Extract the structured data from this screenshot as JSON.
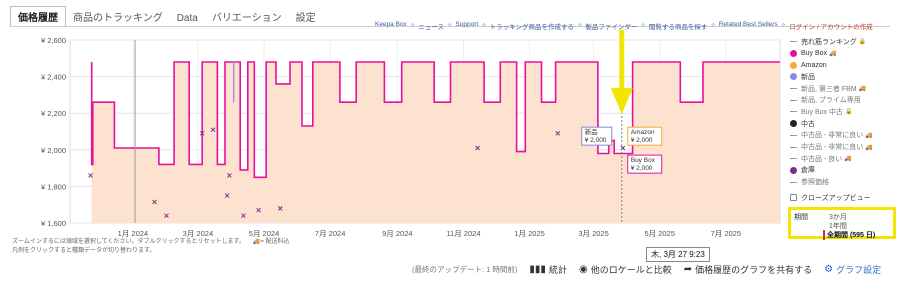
{
  "tabs": [
    "価格履歴",
    "商品のトラッキング",
    "Data",
    "バリエーション",
    "設定"
  ],
  "top_links": [
    "Keepa Box",
    "ニュース",
    "Support",
    "トラッキング商品を作成する",
    "製品ファインダー",
    "閲覧する商品を探す",
    "Related Best Sellers",
    "ログイン / アカウントの作成"
  ],
  "legend": [
    {
      "label": "売れ筋ランキング",
      "color": "",
      "icon": "line",
      "off": false,
      "extra": "lock"
    },
    {
      "label": "Buy Box",
      "color": "#e6109d",
      "icon": "dot",
      "off": false,
      "extra": "truck"
    },
    {
      "label": "Amazon",
      "color": "#f2a93b",
      "icon": "dot",
      "off": false,
      "extra": ""
    },
    {
      "label": "新品",
      "color": "#8888dd",
      "icon": "dot",
      "off": false,
      "extra": ""
    },
    {
      "label": "新品, 第三者 FBM",
      "color": "",
      "icon": "line",
      "off": true,
      "extra": "truck"
    },
    {
      "label": "新品, プライム専用",
      "color": "",
      "icon": "line",
      "off": true,
      "extra": ""
    },
    {
      "label": "Buy Box 中古",
      "color": "",
      "icon": "line",
      "off": true,
      "extra": "lock"
    },
    {
      "label": "中古",
      "color": "#222222",
      "icon": "dot",
      "off": false,
      "extra": ""
    },
    {
      "label": "中古品 - 非常に良い",
      "color": "",
      "icon": "line",
      "off": true,
      "extra": "truck"
    },
    {
      "label": "中古品 - 非常に良い",
      "color": "",
      "icon": "line",
      "off": true,
      "extra": "truck"
    },
    {
      "label": "中古品 - 良い",
      "color": "",
      "icon": "line",
      "off": true,
      "extra": "truck"
    },
    {
      "label": "倉庫",
      "color": "#7b2d8e",
      "icon": "dot",
      "off": false,
      "extra": ""
    },
    {
      "label": "参照価格",
      "color": "",
      "icon": "line",
      "off": true,
      "extra": ""
    },
    {
      "label": "クローズアップビュー",
      "color": "",
      "icon": "toggle",
      "off": false,
      "extra": ""
    }
  ],
  "zoom": {
    "header": "期間",
    "options": [
      "3か月",
      "1年間"
    ],
    "selected": "全期間 (595 日)"
  },
  "notes": [
    "ズームインするには領域を選択してください。ダブルクリックするとリセットします。",
    "凡例をクリックすると種類データが切り替わります。"
  ],
  "truck_note": "= 配送料込",
  "hover": {
    "date": "木, 3月 27 9:23",
    "new_label": "新品",
    "new_price": "¥ 2,000",
    "amazon_label": "Amazon",
    "amazon_price": "¥ 2,000",
    "buybox_label": "Buy Box",
    "buybox_price": "¥ 2,000"
  },
  "footer": {
    "update": "(最終のアップデート: 1 時間前)",
    "stats": "統計",
    "compare": "他のロケールと比較",
    "share": "価格履歴のグラフを共有する",
    "settings": "グラフ設定"
  },
  "chart_data": {
    "type": "line",
    "ylim": [
      1600,
      2600
    ],
    "yticks": [
      1600,
      1800,
      2000,
      2200,
      2400,
      2600
    ],
    "ytick_labels": [
      "¥ 1,600",
      "¥ 1,800",
      "¥ 2,000",
      "¥ 2,200",
      "¥ 2,400",
      "¥ 2,600"
    ],
    "xlim": [
      "2023-11-04",
      "2025-08-20"
    ],
    "xticks": [
      "2024-01-01",
      "2024-03-01",
      "2024-05-01",
      "2024-07-01",
      "2024-09-01",
      "2024-11-01",
      "2025-01-01",
      "2025-03-01",
      "2025-05-01",
      "2025-07-01"
    ],
    "xtick_labels": [
      "1月 2024",
      "3月 2024",
      "5月 2024",
      "7月 2024",
      "9月 2024",
      "11月 2024",
      "1月 2025",
      "3月 2025",
      "5月 2025",
      "7月 2025"
    ],
    "series": [
      {
        "name": "Buy Box",
        "color": "#e6109d",
        "points": [
          [
            "2023-11-24",
            2480
          ],
          [
            "2023-11-24",
            1920
          ],
          [
            "2023-11-25",
            1920
          ],
          [
            "2023-11-25",
            2260
          ],
          [
            "2023-12-15",
            2260
          ],
          [
            "2023-12-15",
            2010
          ],
          [
            "2024-01-25",
            2010
          ],
          [
            "2024-01-25",
            1920
          ],
          [
            "2024-02-08",
            1920
          ],
          [
            "2024-02-08",
            2480
          ],
          [
            "2024-02-22",
            2480
          ],
          [
            "2024-02-22",
            1920
          ],
          [
            "2024-03-05",
            1920
          ],
          [
            "2024-03-05",
            2480
          ],
          [
            "2024-03-19",
            2480
          ],
          [
            "2024-03-19",
            1920
          ],
          [
            "2024-03-26",
            1920
          ],
          [
            "2024-03-26",
            2480
          ],
          [
            "2024-04-09",
            2480
          ],
          [
            "2024-04-09",
            1890
          ],
          [
            "2024-04-16",
            1890
          ],
          [
            "2024-04-16",
            2480
          ],
          [
            "2024-04-22",
            2480
          ],
          [
            "2024-04-22",
            1850
          ],
          [
            "2024-05-03",
            1850
          ],
          [
            "2024-05-03",
            2480
          ],
          [
            "2024-05-12",
            2480
          ],
          [
            "2024-05-12",
            2360
          ],
          [
            "2024-05-25",
            2360
          ],
          [
            "2024-05-25",
            2480
          ],
          [
            "2024-06-05",
            2480
          ],
          [
            "2024-06-05",
            2130
          ],
          [
            "2024-06-15",
            2130
          ],
          [
            "2024-06-15",
            2480
          ],
          [
            "2024-07-10",
            2480
          ],
          [
            "2024-07-10",
            2260
          ],
          [
            "2024-07-25",
            2260
          ],
          [
            "2024-07-25",
            2480
          ],
          [
            "2024-08-20",
            2480
          ],
          [
            "2024-08-20",
            2260
          ],
          [
            "2024-09-05",
            2260
          ],
          [
            "2024-09-05",
            2480
          ],
          [
            "2024-10-05",
            2480
          ],
          [
            "2024-10-05",
            2260
          ],
          [
            "2024-10-20",
            2260
          ],
          [
            "2024-10-20",
            2480
          ],
          [
            "2024-11-20",
            2480
          ],
          [
            "2024-11-20",
            2260
          ],
          [
            "2024-12-05",
            2260
          ],
          [
            "2024-12-05",
            2480
          ],
          [
            "2024-12-20",
            2480
          ],
          [
            "2024-12-20",
            1990
          ],
          [
            "2024-12-28",
            1990
          ],
          [
            "2024-12-28",
            2480
          ],
          [
            "2025-01-12",
            2480
          ],
          [
            "2025-01-12",
            2260
          ],
          [
            "2025-01-25",
            2260
          ],
          [
            "2025-01-25",
            2480
          ],
          [
            "2025-03-05",
            2480
          ],
          [
            "2025-03-05",
            1980
          ],
          [
            "2025-03-15",
            1980
          ],
          [
            "2025-03-15",
            2050
          ],
          [
            "2025-03-20",
            2050
          ],
          [
            "2025-03-20",
            1980
          ],
          [
            "2025-04-06",
            1980
          ],
          [
            "2025-04-06",
            2480
          ],
          [
            "2025-05-20",
            2480
          ],
          [
            "2025-05-20",
            2260
          ],
          [
            "2025-06-10",
            2260
          ],
          [
            "2025-06-10",
            2480
          ],
          [
            "2025-08-20",
            2480
          ]
        ]
      },
      {
        "name": "新品",
        "color": "#8888dd",
        "points": [
          [
            "2024-04-03",
            2260
          ],
          [
            "2024-04-03",
            2480
          ],
          [
            "2024-04-05",
            2480
          ]
        ]
      },
      {
        "name": "中古",
        "color": "#7b2d8e",
        "type": "scatter",
        "points": [
          [
            "2023-11-23",
            1860
          ],
          [
            "2024-01-21",
            1715
          ],
          [
            "2024-02-01",
            1640
          ],
          [
            "2024-03-05",
            2090
          ],
          [
            "2024-03-15",
            2110
          ],
          [
            "2024-03-28",
            1750
          ],
          [
            "2024-03-30",
            1860
          ],
          [
            "2024-04-12",
            1640
          ],
          [
            "2024-04-26",
            1670
          ],
          [
            "2024-05-16",
            1680
          ],
          [
            "2024-11-14",
            2010
          ],
          [
            "2025-01-27",
            2090
          ],
          [
            "2025-03-28",
            2010
          ]
        ]
      }
    ]
  }
}
